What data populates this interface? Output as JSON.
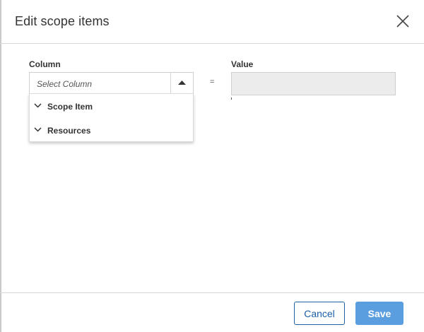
{
  "dialog": {
    "title": "Edit scope items",
    "close_icon": "close-icon"
  },
  "form": {
    "column_label": "Column",
    "value_label": "Value",
    "column_select": {
      "placeholder": "Select Column",
      "toggle_icon": "caret-up-icon",
      "options": [
        {
          "label": "Scope Item",
          "icon": "chevron-down-icon"
        },
        {
          "label": "Resources",
          "icon": "chevron-down-icon"
        }
      ]
    },
    "operator": "=",
    "value_input": {
      "value": ""
    }
  },
  "footer": {
    "cancel_label": "Cancel",
    "save_label": "Save"
  },
  "colors": {
    "primary": "#1a5fa8",
    "save_bg": "#5b9ee0",
    "disabled_input_bg": "#ececec",
    "border": "#d6d6d6"
  }
}
